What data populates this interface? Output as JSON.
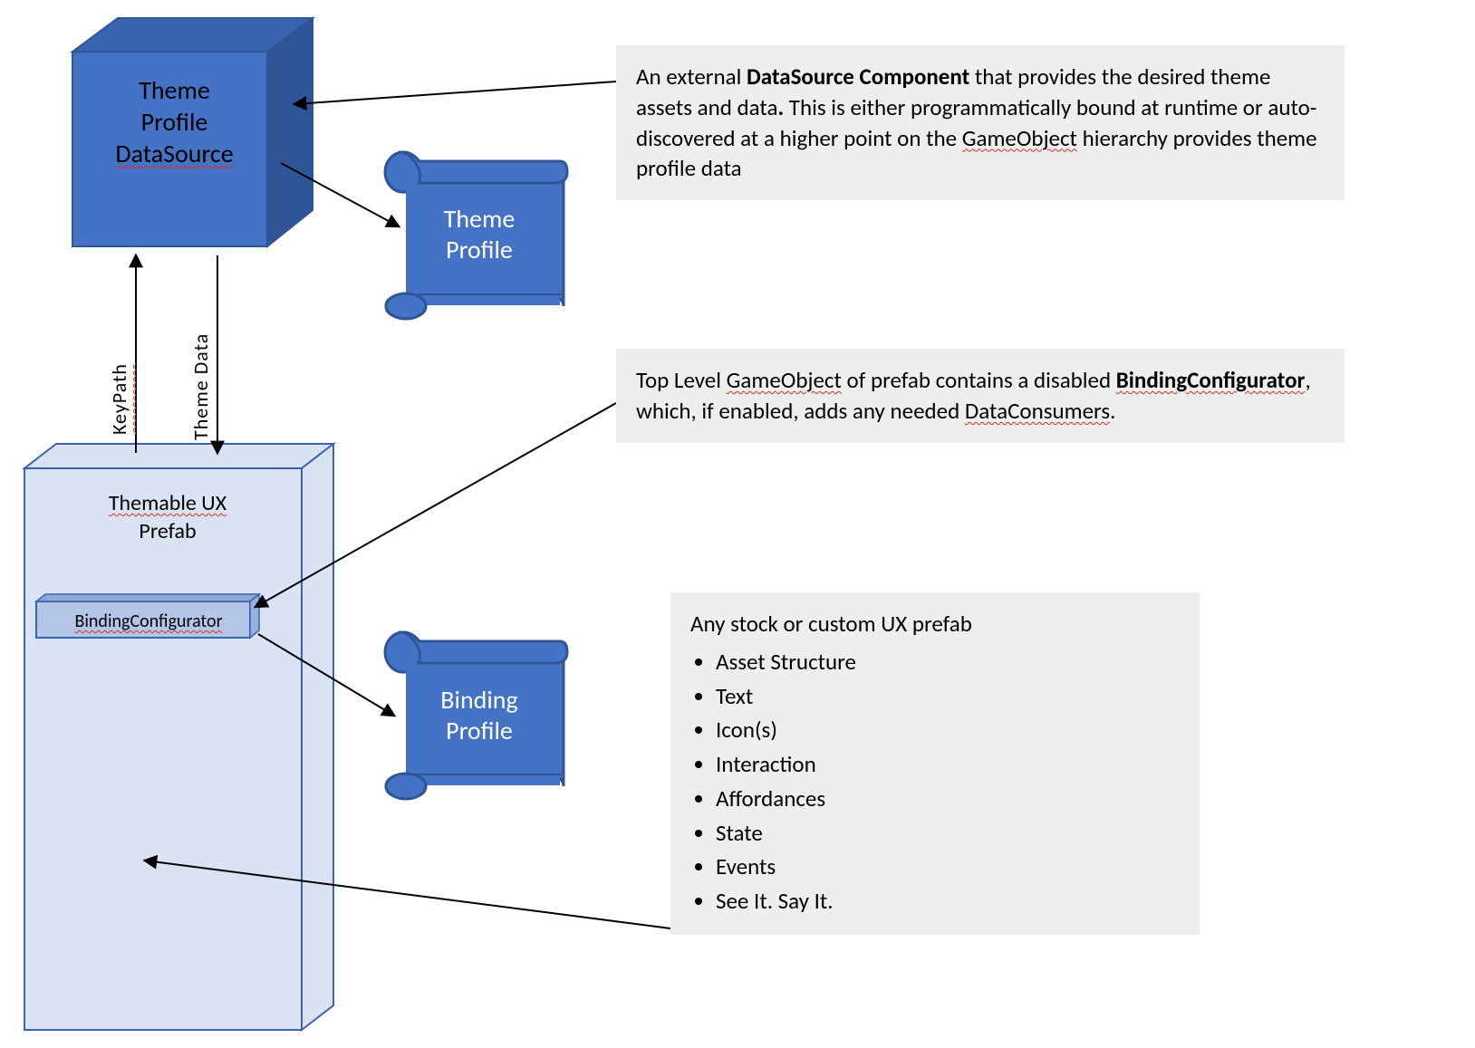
{
  "colors": {
    "cubeLight": "#4472c4",
    "cubeTop": "#3a63b0",
    "cubeDark": "#2f5597",
    "boxFill": "#dae3f3",
    "boxEdge": "#3a63b0",
    "scrollFill": "#4472c4",
    "scrollEdge": "#2f5597",
    "callout": "#eeeeee",
    "arrow": "#000000"
  },
  "cube": {
    "label_line1": "Theme",
    "label_line2": "Profile",
    "label_line3": "DataSource"
  },
  "box": {
    "label_line1": "Themable UX",
    "label_line2": "Prefab",
    "bar_label": "BindingConfigurator"
  },
  "scroll1": {
    "label_line1": "Theme",
    "label_line2": "Profile"
  },
  "scroll2": {
    "label_line1": "Binding",
    "label_line2": "Profile"
  },
  "edges": {
    "keypath": "KeyPath",
    "themedata": "Theme Data"
  },
  "callouts": {
    "c1_pre": "An external ",
    "c1_bold": "DataSource Component",
    "c1_post_a": " that provides the desired theme assets and data",
    "c1_dot": ".",
    "c1_post_b": " This is either programmatically bound at runtime or auto-discovered at a higher point on the ",
    "c1_go": "GameObject",
    "c1_post_c": " hierarchy provides theme profile data",
    "c2_pre": "Top Level ",
    "c2_go": "GameObject",
    "c2_mid_a": " of prefab contains a disabled ",
    "c2_bold": "BindingConfigurator",
    "c2_mid_b": ", which, if enabled, adds any needed ",
    "c2_dc": "DataConsumers",
    "c2_end": ".",
    "c3_title": "Any stock or custom UX prefab",
    "c3_items": [
      "Asset Structure",
      "Text",
      "Icon(s)",
      "Interaction",
      "Affordances",
      "State",
      "Events",
      "See It. Say It."
    ]
  }
}
